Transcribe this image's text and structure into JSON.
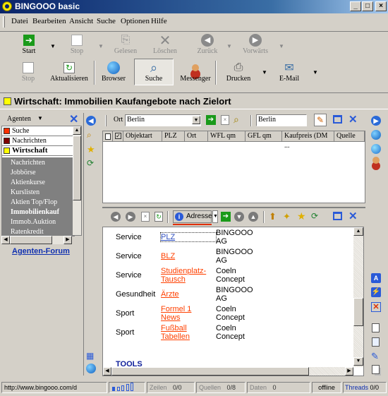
{
  "window": {
    "title": "BINGOOO basic"
  },
  "menu": [
    "Datei",
    "Bearbeiten",
    "Ansicht",
    "Suche",
    "Optionen",
    "Hilfe"
  ],
  "toolbar_top": {
    "start": "Start",
    "stop": "Stop",
    "gelesen": "Gelesen",
    "loeschen": "Löschen",
    "zurueck": "Zurück",
    "vorwaerts": "Vorwärts"
  },
  "toolbar_bottom": {
    "stop": "Stop",
    "aktualisieren": "Aktualisieren",
    "browser": "Browser",
    "suche": "Suche",
    "messenger": "Messenger",
    "drucken": "Drucken",
    "email": "E-Mail"
  },
  "path": {
    "text": "Wirtschaft: Immobilien Kaufangebote nach Zielort"
  },
  "agents": {
    "header": "Agenten",
    "categories": [
      {
        "label": "Suche",
        "color": "#ff3000"
      },
      {
        "label": "Nachrichten",
        "color": "#800000"
      },
      {
        "label": "Wirtschaft",
        "color": "#ffff00"
      }
    ],
    "items": [
      "Nachrichten",
      "Jobbörse",
      "Aktienkurse",
      "Kurslisten",
      "Aktien Top/Flop",
      "Immobilienkauf",
      "Immob.Auktion",
      "Ratenkredit"
    ],
    "active_item": "Immobilienkauf",
    "forum": "Agenten-Forum"
  },
  "search": {
    "field_label": "Ort",
    "field_value": "Berlin",
    "query_value": "Berlin"
  },
  "table": {
    "columns": [
      "Objektart",
      "PLZ",
      "Ort",
      "WFL qm",
      "GFL qm",
      "Kaufpreis (DM ...",
      "Quelle"
    ]
  },
  "browser": {
    "address_label": "Adresse",
    "rows": [
      {
        "cat": "Service",
        "link": "PLZ",
        "prov1": "BINGOOO",
        "prov2": "AG"
      },
      {
        "cat": "Service",
        "link": "BLZ",
        "prov1": "BINGOOO",
        "prov2": "AG"
      },
      {
        "cat": "Service",
        "link": "Studienplatz-",
        "link2": "Tausch",
        "prov1": "Coeln",
        "prov2": "Concept"
      },
      {
        "cat": "Gesundheit",
        "link": "Ärzte",
        "prov1": "BINGOOO",
        "prov2": "AG"
      },
      {
        "cat": "Sport",
        "link": "Formel 1",
        "link2": "News",
        "prov1": "Coeln",
        "prov2": "Concept"
      },
      {
        "cat": "Sport",
        "link": "Fußball",
        "link2": "Tabellen",
        "prov1": "Coeln",
        "prov2": "Concept"
      }
    ],
    "tools_heading": "TOOLS"
  },
  "status": {
    "url": "http://www.bingooo.com/d",
    "zeilen_label": "Zeilen",
    "zeilen_value": "0/0",
    "quellen_label": "Quellen",
    "quellen_value": "0/8",
    "daten_label": "Daten",
    "daten_value": "0",
    "online": "offline",
    "threads_label": "Threads",
    "threads_value": "0/0"
  }
}
